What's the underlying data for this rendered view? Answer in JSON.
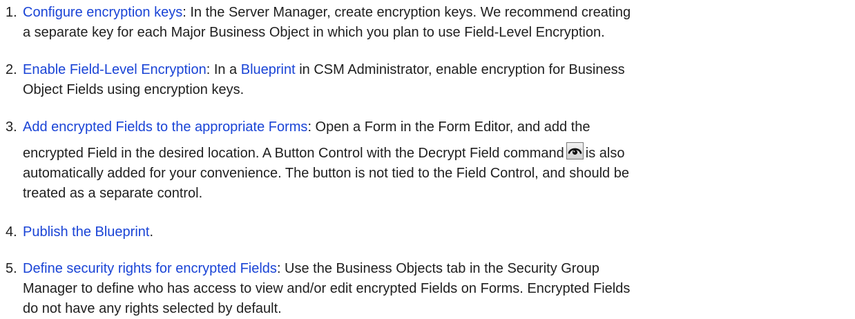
{
  "steps": [
    {
      "number": "1.",
      "link": "Configure encryption keys",
      "line1": ": In the Server Manager, create encryption keys. We recommend creating",
      "line2": "a separate key for each Major Business Object in which you plan to use Field-Level Encryption."
    },
    {
      "number": "2.",
      "link": "Enable Field-Level Encryption",
      "mid1": ": In a ",
      "link2": "Blueprint",
      "line1": " in CSM Administrator, enable encryption for Business",
      "line2": "Object Fields using encryption keys."
    },
    {
      "number": "3.",
      "link": "Add encrypted Fields to the appropriate Forms",
      "line1": ": Open a Form in the Form Editor, and add the",
      "line2a": "encrypted Field in the desired location. A Button Control with the Decrypt Field command",
      "line2b": "is also",
      "line3": "automatically added for your convenience. The button is not tied to the Field Control, and should be",
      "line4": "treated as a separate control.",
      "icon": "decrypt-field-icon"
    },
    {
      "number": "4.",
      "link": "Publish the Blueprint",
      "line1": "."
    },
    {
      "number": "5.",
      "link": "Define security rights for encrypted Fields",
      "line1": ": Use the Business Objects tab in the Security Group",
      "line2": "Manager to define who has access to view and/or edit encrypted Fields on Forms. Encrypted Fields",
      "line3": "do not have any rights selected by default."
    }
  ],
  "colors": {
    "link": "#1a44d6",
    "text": "#1f1f1f"
  }
}
